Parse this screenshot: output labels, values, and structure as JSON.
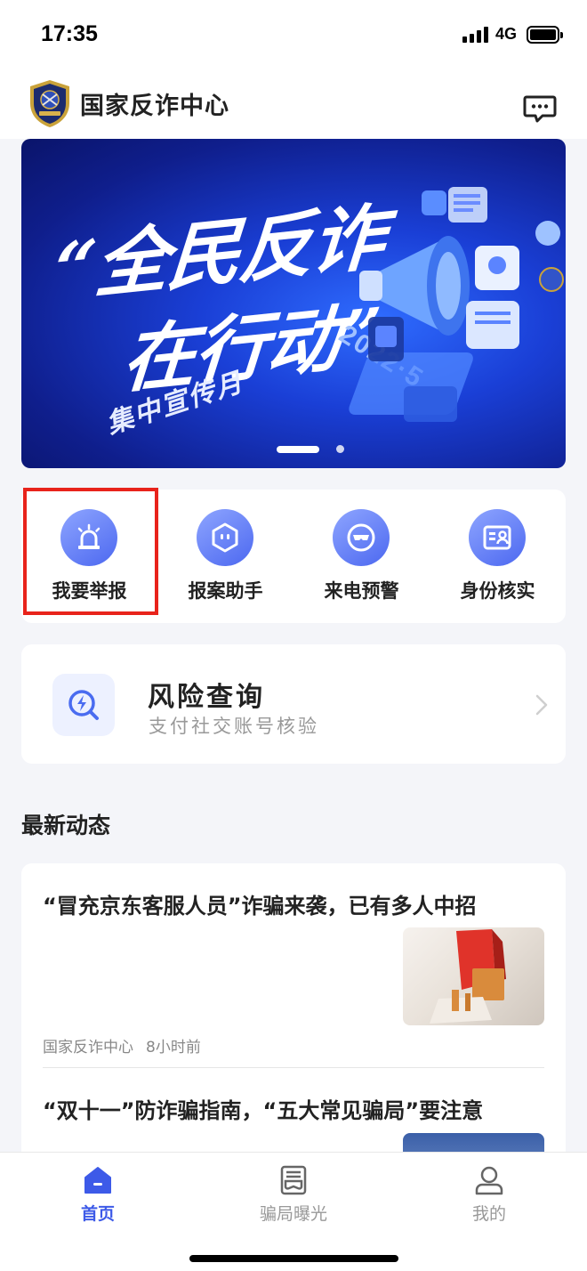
{
  "status_bar": {
    "time": "17:35",
    "network": "4G"
  },
  "header": {
    "title": "国家反诈中心"
  },
  "banner": {
    "line1": "“全民反诈",
    "line2": "在行动”",
    "subtitle": "集中宣传月",
    "date": "2022·5"
  },
  "quick_actions": [
    {
      "label": "我要举报",
      "icon": "alarm-light-icon"
    },
    {
      "label": "报案助手",
      "icon": "robot-hexagon-icon"
    },
    {
      "label": "来电预警",
      "icon": "mask-icon"
    },
    {
      "label": "身份核实",
      "icon": "id-card-icon"
    }
  ],
  "risk_query": {
    "title": "风险查询",
    "subtitle": "支付社交账号核验",
    "icon": "search-lightning-icon"
  },
  "news_section": {
    "title": "最新动态"
  },
  "news": [
    {
      "title": "“冒充京东客服人员”诈骗来袭，已有多人中招",
      "source": "国家反诈中心",
      "time": "8小时前"
    },
    {
      "title": "“双十一”防诈骗指南，“五大常见骗局”要注意"
    }
  ],
  "tabs": [
    {
      "label": "首页",
      "icon": "home-icon",
      "active": true
    },
    {
      "label": "骗局曝光",
      "icon": "mask-doc-icon",
      "active": false
    },
    {
      "label": "我的",
      "icon": "person-icon",
      "active": false
    }
  ],
  "colors": {
    "accent": "#3d5ae8",
    "highlight_border": "#e8231b"
  }
}
